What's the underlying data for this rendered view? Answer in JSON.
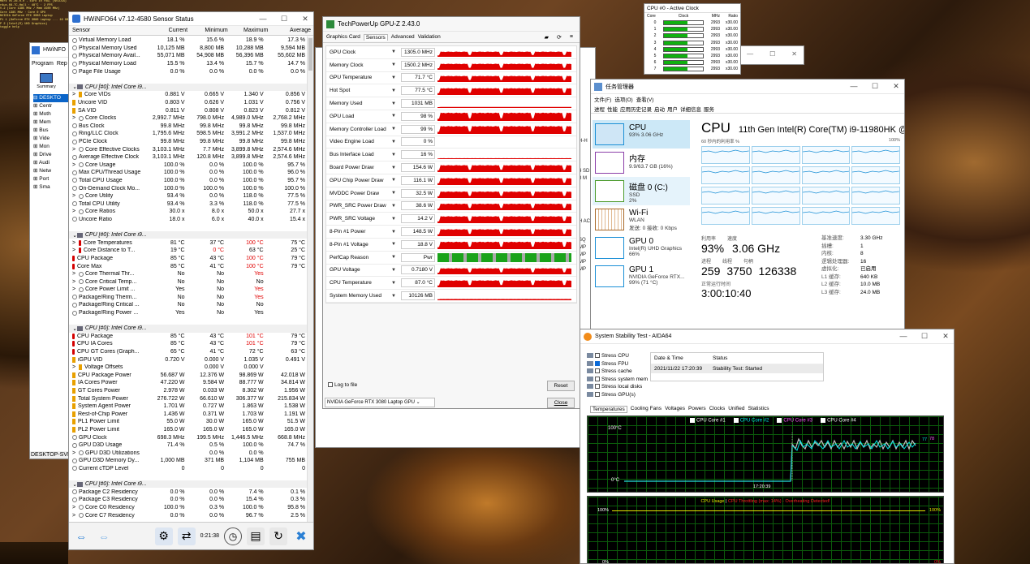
{
  "console": {
    "lines": [
      "Mark v5.26.0.0 - Euro in row, (NVIDIA)",
      "rAux-08-TC-Hall · 48°C · 2 FPS",
      "V.2 (Core 1385 MHz / Mem 1500 MHz)",
      "Core 1385 MHz · Core 0 GPU",
      "NVIDIA GeForce RTX 3080 Laptop",
      "P1 1 (GeForce RTX 3080 Laptop ... 16 GB)",
      "P 2 (Intel(R) UHD Graphics)",
      "toggle help"
    ]
  },
  "hwinfo": {
    "title": "HWiNFO64 v7.12-4580 Sensor Status",
    "cols": [
      "Sensor",
      "Current",
      "Minimum",
      "Maximum",
      "Average"
    ],
    "rows": [
      {
        "n": "Virtual Memory Load",
        "v": [
          "18.1 %",
          "15.6 %",
          "18.9 %",
          "17.3 %"
        ],
        "i": "dot"
      },
      {
        "n": "Physical Memory Used",
        "v": [
          "10,125 MB",
          "8,800 MB",
          "10,288 MB",
          "9,594 MB"
        ],
        "i": "dot"
      },
      {
        "n": "Physical Memory Avail...",
        "v": [
          "55,071 MB",
          "54,908 MB",
          "56,396 MB",
          "55,602 MB"
        ],
        "i": "dot"
      },
      {
        "n": "Physical Memory Load",
        "v": [
          "15.5 %",
          "13.4 %",
          "15.7 %",
          "14.7 %"
        ],
        "i": "dot"
      },
      {
        "n": "Page File Usage",
        "v": [
          "0.0 %",
          "0.0 %",
          "0.0 %",
          "0.0 %"
        ],
        "i": "dot"
      },
      {
        "n": "",
        "v": [
          "",
          "",
          "",
          ""
        ],
        "i": "none"
      },
      {
        "n": "CPU [#0]: Intel Core i9...",
        "v": [
          "",
          "",
          "",
          ""
        ],
        "i": "grp"
      },
      {
        "n": "Core VIDs",
        "v": [
          "0.881 V",
          "0.665 V",
          "1.340 V",
          "0.856 V"
        ],
        "i": "bolt",
        "x": true
      },
      {
        "n": "Uncore VID",
        "v": [
          "0.803 V",
          "0.626 V",
          "1.031 V",
          "0.756 V"
        ],
        "i": "bolt"
      },
      {
        "n": "SA VID",
        "v": [
          "0.811 V",
          "0.808 V",
          "0.823 V",
          "0.812 V"
        ],
        "i": "bolt"
      },
      {
        "n": "Core Clocks",
        "v": [
          "2,992.7 MHz",
          "798.0 MHz",
          "4,989.0 MHz",
          "2,768.2 MHz"
        ],
        "i": "dot",
        "x": true
      },
      {
        "n": "Bus Clock",
        "v": [
          "99.8 MHz",
          "99.8 MHz",
          "99.8 MHz",
          "99.8 MHz"
        ],
        "i": "dot"
      },
      {
        "n": "Ring/LLC Clock",
        "v": [
          "1,795.6 MHz",
          "598.5 MHz",
          "3,991.2 MHz",
          "1,537.0 MHz"
        ],
        "i": "dot"
      },
      {
        "n": "PCIe Clock",
        "v": [
          "99.8 MHz",
          "99.8 MHz",
          "99.8 MHz",
          "99.8 MHz"
        ],
        "i": "dot"
      },
      {
        "n": "Core Effective Clocks",
        "v": [
          "3,103.1 MHz",
          "7.7 MHz",
          "3,899.8 MHz",
          "2,574.6 MHz"
        ],
        "i": "dot",
        "x": true
      },
      {
        "n": "Average Effective Clock",
        "v": [
          "3,103.1 MHz",
          "120.8 MHz",
          "3,899.8 MHz",
          "2,574.6 MHz"
        ],
        "i": "dot"
      },
      {
        "n": "Core Usage",
        "v": [
          "100.0 %",
          "0.0 %",
          "100.0 %",
          "95.7 %"
        ],
        "i": "dot",
        "x": true
      },
      {
        "n": "Max CPU/Thread Usage",
        "v": [
          "100.0 %",
          "0.0 %",
          "100.0 %",
          "96.0 %"
        ],
        "i": "dot"
      },
      {
        "n": "Total CPU Usage",
        "v": [
          "100.0 %",
          "0.0 %",
          "100.0 %",
          "95.7 %"
        ],
        "i": "dot"
      },
      {
        "n": "On-Demand Clock Mo...",
        "v": [
          "100.0 %",
          "100.0 %",
          "100.0 %",
          "100.0 %"
        ],
        "i": "dot"
      },
      {
        "n": "Core Utility",
        "v": [
          "93.4 %",
          "0.0 %",
          "118.0 %",
          "77.5 %"
        ],
        "i": "dot",
        "x": true
      },
      {
        "n": "Total CPU Utility",
        "v": [
          "93.4 %",
          "3.3 %",
          "118.0 %",
          "77.5 %"
        ],
        "i": "dot"
      },
      {
        "n": "Core Ratios",
        "v": [
          "30.0 x",
          "8.0 x",
          "50.0 x",
          "27.7 x"
        ],
        "i": "dot",
        "x": true
      },
      {
        "n": "Uncore Ratio",
        "v": [
          "18.0 x",
          "6.0 x",
          "40.0 x",
          "15.4 x"
        ],
        "i": "dot"
      },
      {
        "n": "",
        "v": [
          "",
          "",
          "",
          ""
        ],
        "i": "none"
      },
      {
        "n": "CPU [#0]: Intel Core i9...",
        "v": [
          "",
          "",
          "",
          ""
        ],
        "i": "grp"
      },
      {
        "n": "Core Temperatures",
        "v": [
          "81 °C",
          "37 °C",
          "100 °C",
          "75 °C"
        ],
        "i": "therm",
        "x": true,
        "r": 2
      },
      {
        "n": "Core Distance to T...",
        "v": [
          "19 °C",
          "0 °C",
          "63 °C",
          "25 °C"
        ],
        "i": "therm",
        "x": true,
        "r": 1
      },
      {
        "n": "CPU Package",
        "v": [
          "85 °C",
          "43 °C",
          "100 °C",
          "79 °C"
        ],
        "i": "therm",
        "r": 2
      },
      {
        "n": "Core Max",
        "v": [
          "85 °C",
          "41 °C",
          "100 °C",
          "79 °C"
        ],
        "i": "therm",
        "r": 2
      },
      {
        "n": "Core Thermal Thr...",
        "v": [
          "No",
          "No",
          "Yes",
          ""
        ],
        "i": "dot",
        "x": true,
        "r": 2
      },
      {
        "n": "Core Critical Temp...",
        "v": [
          "No",
          "No",
          "No",
          ""
        ],
        "i": "dot",
        "x": true
      },
      {
        "n": "Core Power Limit ...",
        "v": [
          "Yes",
          "No",
          "Yes",
          ""
        ],
        "i": "dot",
        "x": true,
        "r": 2
      },
      {
        "n": "Package/Ring Therm...",
        "v": [
          "No",
          "No",
          "Yes",
          ""
        ],
        "i": "dot",
        "r": 2
      },
      {
        "n": "Package/Ring Critical ...",
        "v": [
          "No",
          "No",
          "No",
          ""
        ],
        "i": "dot"
      },
      {
        "n": "Package/Ring Power ...",
        "v": [
          "Yes",
          "No",
          "Yes",
          ""
        ],
        "i": "dot"
      },
      {
        "n": "",
        "v": [
          "",
          "",
          "",
          ""
        ],
        "i": "none"
      },
      {
        "n": "CPU [#0]: Intel Core i9...",
        "v": [
          "",
          "",
          "",
          ""
        ],
        "i": "grp"
      },
      {
        "n": "CPU Package",
        "v": [
          "85 °C",
          "43 °C",
          "101 °C",
          "79 °C"
        ],
        "i": "therm",
        "r": 2
      },
      {
        "n": "CPU IA Cores",
        "v": [
          "85 °C",
          "43 °C",
          "101 °C",
          "79 °C"
        ],
        "i": "therm",
        "r": 2
      },
      {
        "n": "CPU GT Cores (Graph...",
        "v": [
          "65 °C",
          "41 °C",
          "72 °C",
          "63 °C"
        ],
        "i": "therm"
      },
      {
        "n": "iGPU VID",
        "v": [
          "0.720 V",
          "0.000 V",
          "1.035 V",
          "0.491 V"
        ],
        "i": "bolt"
      },
      {
        "n": "Voltage Offsets",
        "v": [
          "",
          "0.000 V",
          "0.000 V",
          ""
        ],
        "i": "bolt",
        "x": true
      },
      {
        "n": "CPU Package Power",
        "v": [
          "56.687 W",
          "12.376 W",
          "98.869 W",
          "42.018 W"
        ],
        "i": "bolt"
      },
      {
        "n": "IA Cores Power",
        "v": [
          "47.220 W",
          "9.584 W",
          "88.777 W",
          "34.814 W"
        ],
        "i": "bolt"
      },
      {
        "n": "GT Cores Power",
        "v": [
          "2.978 W",
          "0.033 W",
          "8.302 W",
          "1.956 W"
        ],
        "i": "bolt"
      },
      {
        "n": "Total System Power",
        "v": [
          "276.722 W",
          "66.610 W",
          "306.377 W",
          "215.834 W"
        ],
        "i": "bolt"
      },
      {
        "n": "System Agent Power",
        "v": [
          "1.701 W",
          "0.727 W",
          "1.863 W",
          "1.538 W"
        ],
        "i": "bolt"
      },
      {
        "n": "Rest-of-Chip Power",
        "v": [
          "1.436 W",
          "0.371 W",
          "1.703 W",
          "1.191 W"
        ],
        "i": "bolt"
      },
      {
        "n": "PL1 Power Limit",
        "v": [
          "55.0 W",
          "30.0 W",
          "165.0 W",
          "51.5 W"
        ],
        "i": "bolt"
      },
      {
        "n": "PL2 Power Limit",
        "v": [
          "165.0 W",
          "165.0 W",
          "165.0 W",
          "165.0 W"
        ],
        "i": "bolt"
      },
      {
        "n": "GPU Clock",
        "v": [
          "698.3 MHz",
          "199.5 MHz",
          "1,446.5 MHz",
          "668.8 MHz"
        ],
        "i": "dot"
      },
      {
        "n": "GPU D3D Usage",
        "v": [
          "71.4 %",
          "0.5 %",
          "100.0 %",
          "74.7 %"
        ],
        "i": "dot"
      },
      {
        "n": "GPU D3D Utilizations",
        "v": [
          "",
          "0.0 %",
          "0.0 %",
          ""
        ],
        "i": "dot",
        "x": true
      },
      {
        "n": "GPU D3D Memory Dy...",
        "v": [
          "1,000 MB",
          "371 MB",
          "1,104 MB",
          "755 MB"
        ],
        "i": "dot"
      },
      {
        "n": "Current cTDP Level",
        "v": [
          "0",
          "0",
          "0",
          "0"
        ],
        "i": "dot"
      },
      {
        "n": "",
        "v": [
          "",
          "",
          "",
          ""
        ],
        "i": "none"
      },
      {
        "n": "CPU [#0]: Intel Core i9...",
        "v": [
          "",
          "",
          "",
          ""
        ],
        "i": "grp"
      },
      {
        "n": "Package C2 Residency",
        "v": [
          "0.0 %",
          "0.0 %",
          "7.4 %",
          "0.1 %"
        ],
        "i": "dot"
      },
      {
        "n": "Package C3 Residency",
        "v": [
          "0.0 %",
          "0.0 %",
          "15.4 %",
          "0.3 %"
        ],
        "i": "dot"
      },
      {
        "n": "Core C0 Residency",
        "v": [
          "100.0 %",
          "0.3 %",
          "100.0 %",
          "95.8 %"
        ],
        "i": "dot",
        "x": true
      },
      {
        "n": "Core C7 Residency",
        "v": [
          "0.0 %",
          "0.0 %",
          "96.7 %",
          "2.5 %"
        ],
        "i": "dot",
        "x": true
      }
    ],
    "timer": "0:21:38"
  },
  "hwmain": {
    "title": "HWiNFO",
    "menu": [
      "Program",
      "Rep"
    ],
    "summary": "Summary",
    "tree": [
      "DESKTO",
      "Centr",
      "Moth",
      "Mem",
      "Bus",
      "Vide",
      "Mon",
      "Drive",
      "Audi",
      "Netw",
      "Port",
      "Sma"
    ],
    "status": "DESKTOP-SVF"
  },
  "gpuz": {
    "title": "TechPowerUp GPU-Z 2.43.0",
    "tabs": [
      "Graphics Card",
      "Sensors",
      "Advanced",
      "Validation"
    ],
    "rows": [
      {
        "n": "GPU Clock",
        "v": "1305.0 MHz",
        "f": 0.6
      },
      {
        "n": "Memory Clock",
        "v": "1500.2 MHz",
        "f": 0.7
      },
      {
        "n": "GPU Temperature",
        "v": "71.7 °C",
        "f": 0.7
      },
      {
        "n": "Hot Spot",
        "v": "77.5 °C",
        "f": 0.78
      },
      {
        "n": "Memory Used",
        "v": "1031 MB",
        "f": 0.12
      },
      {
        "n": "GPU Load",
        "v": "98 %",
        "f": 0.95
      },
      {
        "n": "Memory Controller Load",
        "v": "99 %",
        "f": 0.9
      },
      {
        "n": "Video Engine Load",
        "v": "0 %",
        "f": 0
      },
      {
        "n": "Bus Interface Load",
        "v": "16 %",
        "f": 0.1
      },
      {
        "n": "Board Power Draw",
        "v": "154.6 W",
        "f": 0.8
      },
      {
        "n": "GPU Chip Power Draw",
        "v": "116.1 W",
        "f": 0.8
      },
      {
        "n": "MVDDC Power Draw",
        "v": "32.5 W",
        "f": 0.75
      },
      {
        "n": "PWR_SRC Power Draw",
        "v": "38.6 W",
        "f": 0.75
      },
      {
        "n": "PWR_SRC Voltage",
        "v": "14.2 V",
        "f": 0.8
      },
      {
        "n": "8-Pin #1 Power",
        "v": "148.5 W",
        "f": 0.8
      },
      {
        "n": "8-Pin #1 Voltage",
        "v": "18.8 V",
        "f": 0.85
      },
      {
        "n": "PerfCap Reason",
        "v": "Pwr",
        "f": 1
      },
      {
        "n": "GPU Voltage",
        "v": "0.7180 V",
        "f": 0.7
      },
      {
        "n": "CPU Temperature",
        "v": "87.0 °C",
        "f": 0.8
      },
      {
        "n": "System Memory Used",
        "v": "10126 MB",
        "f": 0.15
      }
    ],
    "log": "Log to file",
    "reset": "Reset",
    "device": "NVIDIA GeForce RTX 3080 Laptop GPU",
    "close": "Close"
  },
  "clock": {
    "title": "CPU #0 - Active Clock",
    "cols": [
      "Core",
      "Clock",
      "MHz",
      "Ratio"
    ],
    "rows": [
      [
        "0",
        "2993",
        "x30.00"
      ],
      [
        "1",
        "2993",
        "x30.00"
      ],
      [
        "2",
        "2993",
        "x30.00"
      ],
      [
        "3",
        "2993",
        "x30.00"
      ],
      [
        "4",
        "2993",
        "x30.00"
      ],
      [
        "5",
        "2993",
        "x30.00"
      ],
      [
        "6",
        "2993",
        "x30.00"
      ],
      [
        "7",
        "2993",
        "x30.00"
      ]
    ]
  },
  "taskman": {
    "title": "任务管理器",
    "menu": [
      "文件(F)",
      "选项(O)",
      "查看(V)"
    ],
    "tabs": [
      "进程",
      "性能",
      "应用历史记录",
      "启动",
      "用户",
      "详细信息",
      "服务"
    ],
    "side": [
      {
        "t": "CPU",
        "s": "93% 3.06 GHz",
        "s2": ""
      },
      {
        "t": "内存",
        "s": "9.9/63.7 GB (16%)",
        "s2": ""
      },
      {
        "t": "磁盘 0 (C:)",
        "s": "SSD",
        "s2": "2%"
      },
      {
        "t": "Wi-Fi",
        "s": "WLAN",
        "s2": "发送: 0 接收: 0 Kbps"
      },
      {
        "t": "GPU 0",
        "s": "Intel(R) UHD Graphics",
        "s2": "66%"
      },
      {
        "t": "GPU 1",
        "s": "NVIDIA GeForce RTX...",
        "s2": "99% (71 °C)"
      }
    ],
    "cpu": "CPU",
    "model": "11th Gen Intel(R) Core(TM) i9-11980HK @ ...",
    "graphlbl": "60 秒内的利用率 %",
    "graphmax": "100%",
    "util_l": "利用率",
    "util": "93%",
    "speed_l": "速度",
    "speed": "3.06 GHz",
    "proc_l": "进程",
    "proc": "259",
    "thr_l": "线程",
    "thr": "3750",
    "hnd_l": "句柄",
    "hnd": "126338",
    "up_l": "正常运行时间",
    "up": "3:00:10:40",
    "specs": [
      [
        "基准速度:",
        "3.30 GHz"
      ],
      [
        "插槽:",
        "1"
      ],
      [
        "内核:",
        "8"
      ],
      [
        "逻辑处理器:",
        "16"
      ],
      [
        "虚拟化:",
        "已启用"
      ],
      [
        "L1 缓存:",
        "640 KB"
      ],
      [
        "L2 缓存:",
        "10.0 MB"
      ],
      [
        "L3 缓存:",
        "24.0 MB"
      ]
    ]
  },
  "aida": {
    "title": "System Stability Test - AIDA64",
    "stress": [
      {
        "l": "Stress CPU",
        "c": false
      },
      {
        "l": "Stress FPU",
        "c": true
      },
      {
        "l": "Stress cache",
        "c": false
      },
      {
        "l": "Stress system mem",
        "c": false
      },
      {
        "l": "Stress local disks",
        "c": false
      },
      {
        "l": "Stress GPU(s)",
        "c": false
      }
    ],
    "dt_h": "Date & Time",
    "st_h": "Status",
    "dt": "2021/11/22 17:20:39",
    "st": "Stability Test: Started",
    "tabs": [
      "Temperatures",
      "Cooling Fans",
      "Voltages",
      "Powers",
      "Clocks",
      "Unified",
      "Statistics"
    ],
    "legend": [
      "CPU Core #1",
      "CPU Core #2",
      "CPU Core #3",
      "CPU Core #4"
    ],
    "legend_colors": [
      "#ffffff",
      "#00e5e5",
      "#ff55ff",
      "#ffffff"
    ],
    "t_top": "100°C",
    "t_bot": "0°C",
    "t_time": "17:20:39",
    "t_v1": "77",
    "t_v2": "78",
    "u_title": "CPU Usage",
    "u_sep": "|",
    "u_throt": "CPU Throttling (max: 14%) - Overheating Detected!",
    "u_top": "100%",
    "u_bot": "0%",
    "u_top_r": "100%",
    "u_bot_r": "0%"
  },
  "ghosts": {
    "ac": "H AC",
    "sq": "SQ",
    "n4": "4 SD",
    "n8": "8 M",
    "ha": "H-H",
    "mp": "MP"
  }
}
